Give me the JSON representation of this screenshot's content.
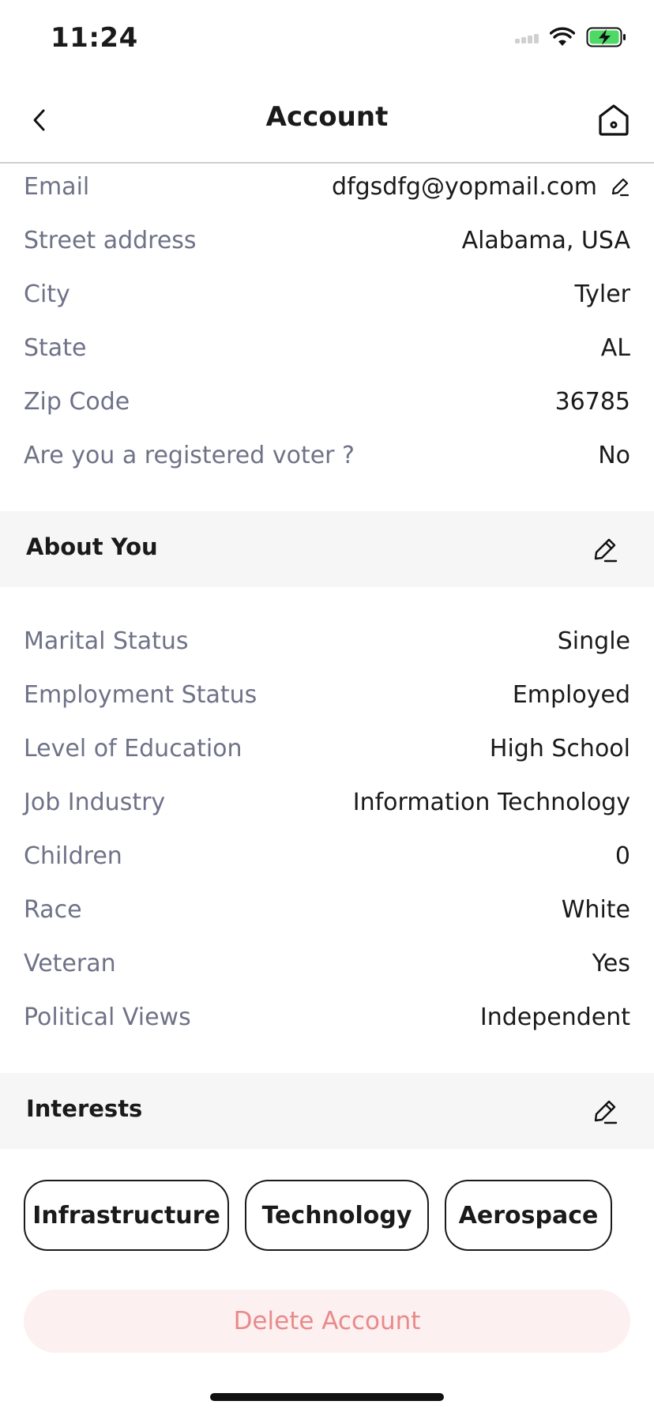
{
  "status_bar": {
    "time": "11:24"
  },
  "header": {
    "title": "Account"
  },
  "account_rows": [
    {
      "label": "Email",
      "value": "dfgsdfg@yopmail.com",
      "editable": true
    },
    {
      "label": "Street address",
      "value": "Alabama, USA"
    },
    {
      "label": "City",
      "value": "Tyler"
    },
    {
      "label": "State",
      "value": "AL"
    },
    {
      "label": "Zip Code",
      "value": "36785"
    },
    {
      "label": "Are you a registered voter ?",
      "value": "No"
    }
  ],
  "about_you": {
    "title": "About You",
    "rows": [
      {
        "label": "Marital Status",
        "value": "Single"
      },
      {
        "label": "Employment Status",
        "value": "Employed"
      },
      {
        "label": "Level of Education",
        "value": "High School"
      },
      {
        "label": "Job Industry",
        "value": "Information Technology"
      },
      {
        "label": "Children",
        "value": "0"
      },
      {
        "label": "Race",
        "value": "White"
      },
      {
        "label": "Veteran",
        "value": "Yes"
      },
      {
        "label": "Political Views",
        "value": "Independent"
      }
    ]
  },
  "interests": {
    "title": "Interests",
    "chips": [
      "Infrastructure",
      "Technology",
      "Aerospace"
    ]
  },
  "delete_button": {
    "label": "Delete Account"
  },
  "colors": {
    "label_text": "#6f7287",
    "value_text": "#1a1a1a",
    "section_bg": "#f6f6f6",
    "delete_bg": "#fdf0f0",
    "delete_text": "#e98a8a",
    "battery_green": "#4cd964"
  },
  "icons": {
    "back": "chevron-left-icon",
    "home": "home-icon",
    "edit": "pencil-icon"
  }
}
